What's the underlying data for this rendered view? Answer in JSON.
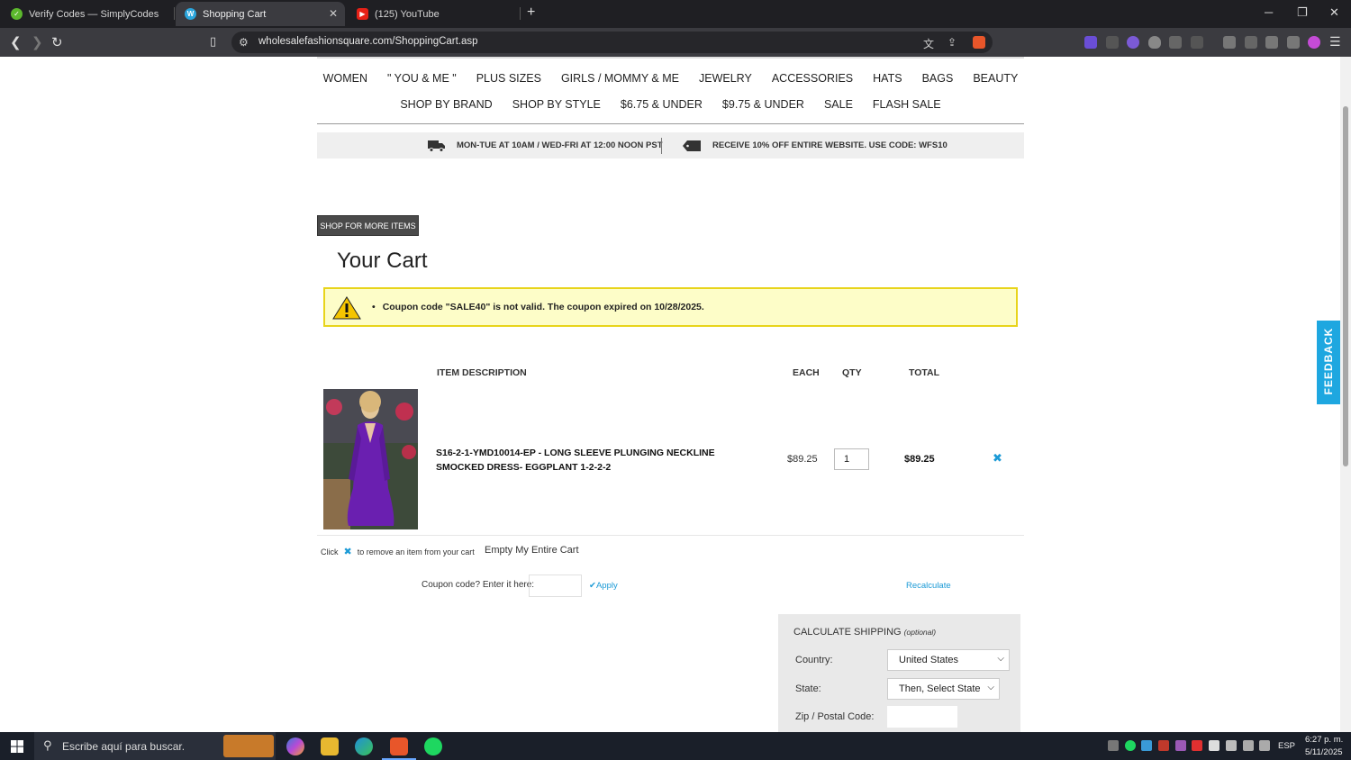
{
  "browser": {
    "tabs": [
      {
        "title": "Verify Codes — SimplyCodes",
        "active": false
      },
      {
        "title": "Shopping Cart",
        "active": true
      },
      {
        "title": "(125) YouTube",
        "active": false
      }
    ],
    "url": "wholesalefashionsquare.com/ShoppingCart.asp"
  },
  "nav": {
    "row1": [
      "WOMEN",
      "\" YOU & ME \"",
      "PLUS SIZES",
      "GIRLS / MOMMY & ME",
      "JEWELRY",
      "ACCESSORIES",
      "HATS",
      "BAGS",
      "BEAUTY"
    ],
    "row2": [
      "SHOP BY BRAND",
      "SHOP BY STYLE",
      "$6.75 & UNDER",
      "$9.75 & UNDER",
      "SALE",
      "FLASH SALE"
    ]
  },
  "promo": {
    "shipping": "MON-TUE AT 10AM / WED-FRI AT 12:00 NOON PST",
    "discount": "RECEIVE 10% OFF ENTIRE WEBSITE. USE CODE: WFS10"
  },
  "cart": {
    "shop_more": "SHOP FOR MORE ITEMS",
    "title": "Your Cart",
    "alert": "Coupon code \"SALE40\" is not valid. The coupon expired on 10/28/2025.",
    "headers": {
      "item": "ITEM  DESCRIPTION",
      "each": "EACH",
      "qty": "QTY",
      "total": "TOTAL"
    },
    "item": {
      "name": "S16-2-1-YMD10014-EP - LONG SLEEVE PLUNGING NECKLINE SMOCKED DRESS- EGGPLANT 1-2-2-2",
      "each": "$89.25",
      "qty": "1",
      "total": "$89.25"
    },
    "hint_click": "Click",
    "hint_rest": "to remove an item from your cart",
    "empty": "Empty My Entire Cart",
    "coupon_label": "Coupon code? Enter it here:",
    "apply": "Apply",
    "recalculate": "Recalculate"
  },
  "shipping": {
    "title": "CALCULATE SHIPPING",
    "optional": "(optional)",
    "country_label": "Country:",
    "country_value": "United States",
    "state_label": "State:",
    "state_value": "Then, Select State",
    "zip_label": "Zip / Postal Code:"
  },
  "feedback": "FEEDBACK",
  "taskbar": {
    "search_placeholder": "Escribe aquí para buscar.",
    "lang": "ESP",
    "time": "6:27 p. m.",
    "date": "5/11/2025"
  },
  "colors": {
    "accent": "#1b9ad6",
    "alert_bg": "#fdfdc8",
    "alert_border": "#e8d41b",
    "feedback": "#1ea7e0"
  }
}
